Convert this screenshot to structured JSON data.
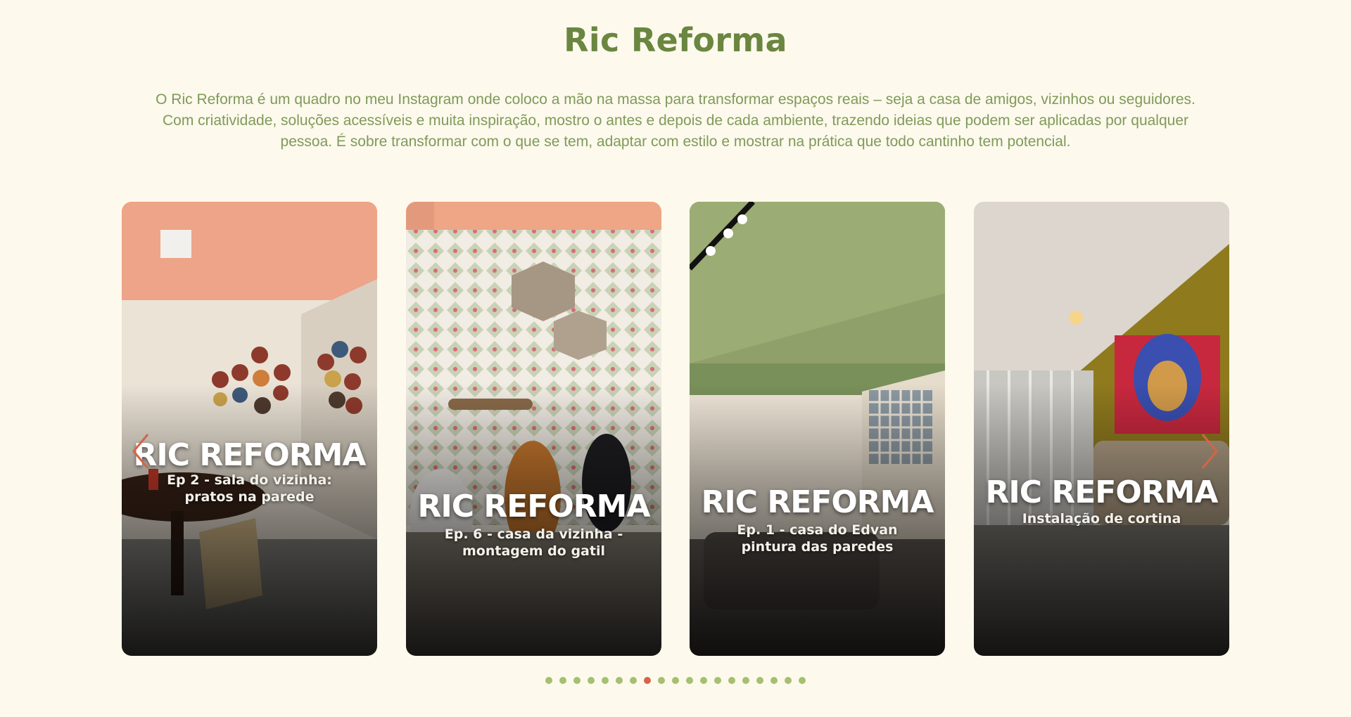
{
  "section": {
    "title": "Ric Reforma",
    "description": "O Ric Reforma é um quadro no meu Instagram onde coloco a mão na massa para transformar espaços reais – seja a casa de amigos, vizinhos ou seguidores. Com criatividade, soluções acessíveis e muita inspiração, mostro o antes e depois de cada ambiente, trazendo ideias que podem ser aplicadas por qualquer pessoa. É sobre transformar com o que se tem, adaptar com estilo e mostrar na prática que todo cantinho tem potencial."
  },
  "cards": [
    {
      "heading": "RIC REFORMA",
      "subtitle": "Ep 2 - sala  do vizinha:\npratos na parede"
    },
    {
      "heading": "RIC REFORMA",
      "subtitle": "Ep. 6 - casa da vizinha -\nmontagem do gatil"
    },
    {
      "heading": "RIC REFORMA",
      "subtitle": "Ep. 1 - casa do Edvan\npintura das paredes"
    },
    {
      "heading": "RIC REFORMA",
      "subtitle": "Instalação de cortina"
    }
  ],
  "carousel": {
    "prev_icon": "chevron-left-icon",
    "next_icon": "chevron-right-icon",
    "total_slides": 19,
    "active_slide": 8
  },
  "colors": {
    "background": "#fdf9ec",
    "title": "#6a8640",
    "text": "#7f9a5a",
    "dot": "#a4c070",
    "dot_active": "#d4654a",
    "arrow": "#d4654a"
  }
}
